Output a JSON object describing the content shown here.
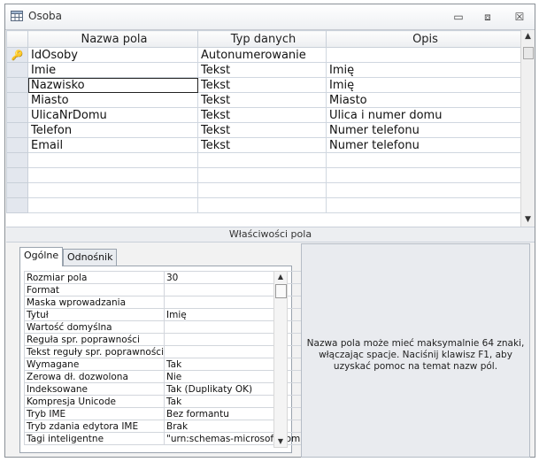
{
  "window": {
    "title": "Osoba",
    "icons": {
      "table": "table-icon",
      "minimize": "minimize-icon",
      "maximize": "maximize-icon",
      "close": "close-icon"
    }
  },
  "grid": {
    "headers": [
      "Nazwa pola",
      "Typ danych",
      "Opis"
    ],
    "rows": [
      {
        "name": "IdOsoby",
        "type": "Autonumerowanie",
        "desc": "",
        "key": true
      },
      {
        "name": "Imie",
        "type": "Tekst",
        "desc": "Imię"
      },
      {
        "name": "Nazwisko",
        "type": "Tekst",
        "desc": "Imię",
        "focused": true
      },
      {
        "name": "Miasto",
        "type": "Tekst",
        "desc": "Miasto"
      },
      {
        "name": "UlicaNrDomu",
        "type": "Tekst",
        "desc": "Ulica i numer domu"
      },
      {
        "name": "Telefon",
        "type": "Tekst",
        "desc": "Numer telefonu"
      },
      {
        "name": "Email",
        "type": "Tekst",
        "desc": "Numer telefonu"
      }
    ]
  },
  "properties_label": "Właściwości pola",
  "tabs": {
    "general": "Ogólne",
    "lookup": "Odnośnik"
  },
  "properties": [
    {
      "label": "Rozmiar pola",
      "value": "30"
    },
    {
      "label": "Format",
      "value": ""
    },
    {
      "label": "Maska wprowadzania",
      "value": ""
    },
    {
      "label": "Tytuł",
      "value": "Imię"
    },
    {
      "label": "Wartość domyślna",
      "value": ""
    },
    {
      "label": "Reguła spr. poprawności",
      "value": ""
    },
    {
      "label": "Tekst reguły spr. poprawności",
      "value": ""
    },
    {
      "label": "Wymagane",
      "value": "Tak"
    },
    {
      "label": "Zerowa dł. dozwolona",
      "value": "Nie"
    },
    {
      "label": "Indeksowane",
      "value": "Tak (Duplikaty OK)"
    },
    {
      "label": "Kompresja Unicode",
      "value": "Tak"
    },
    {
      "label": "Tryb IME",
      "value": "Bez formantu"
    },
    {
      "label": "Tryb zdania edytora IME",
      "value": "Brak"
    },
    {
      "label": "Tagi inteligentne",
      "value": "\"urn:schemas-microsoft-com:"
    }
  ],
  "help_text": "Nazwa pola może mieć maksymalnie 64 znaki, włączając spacje. Naciśnij klawisz F1, aby uzyskać pomoc na temat nazw pól."
}
